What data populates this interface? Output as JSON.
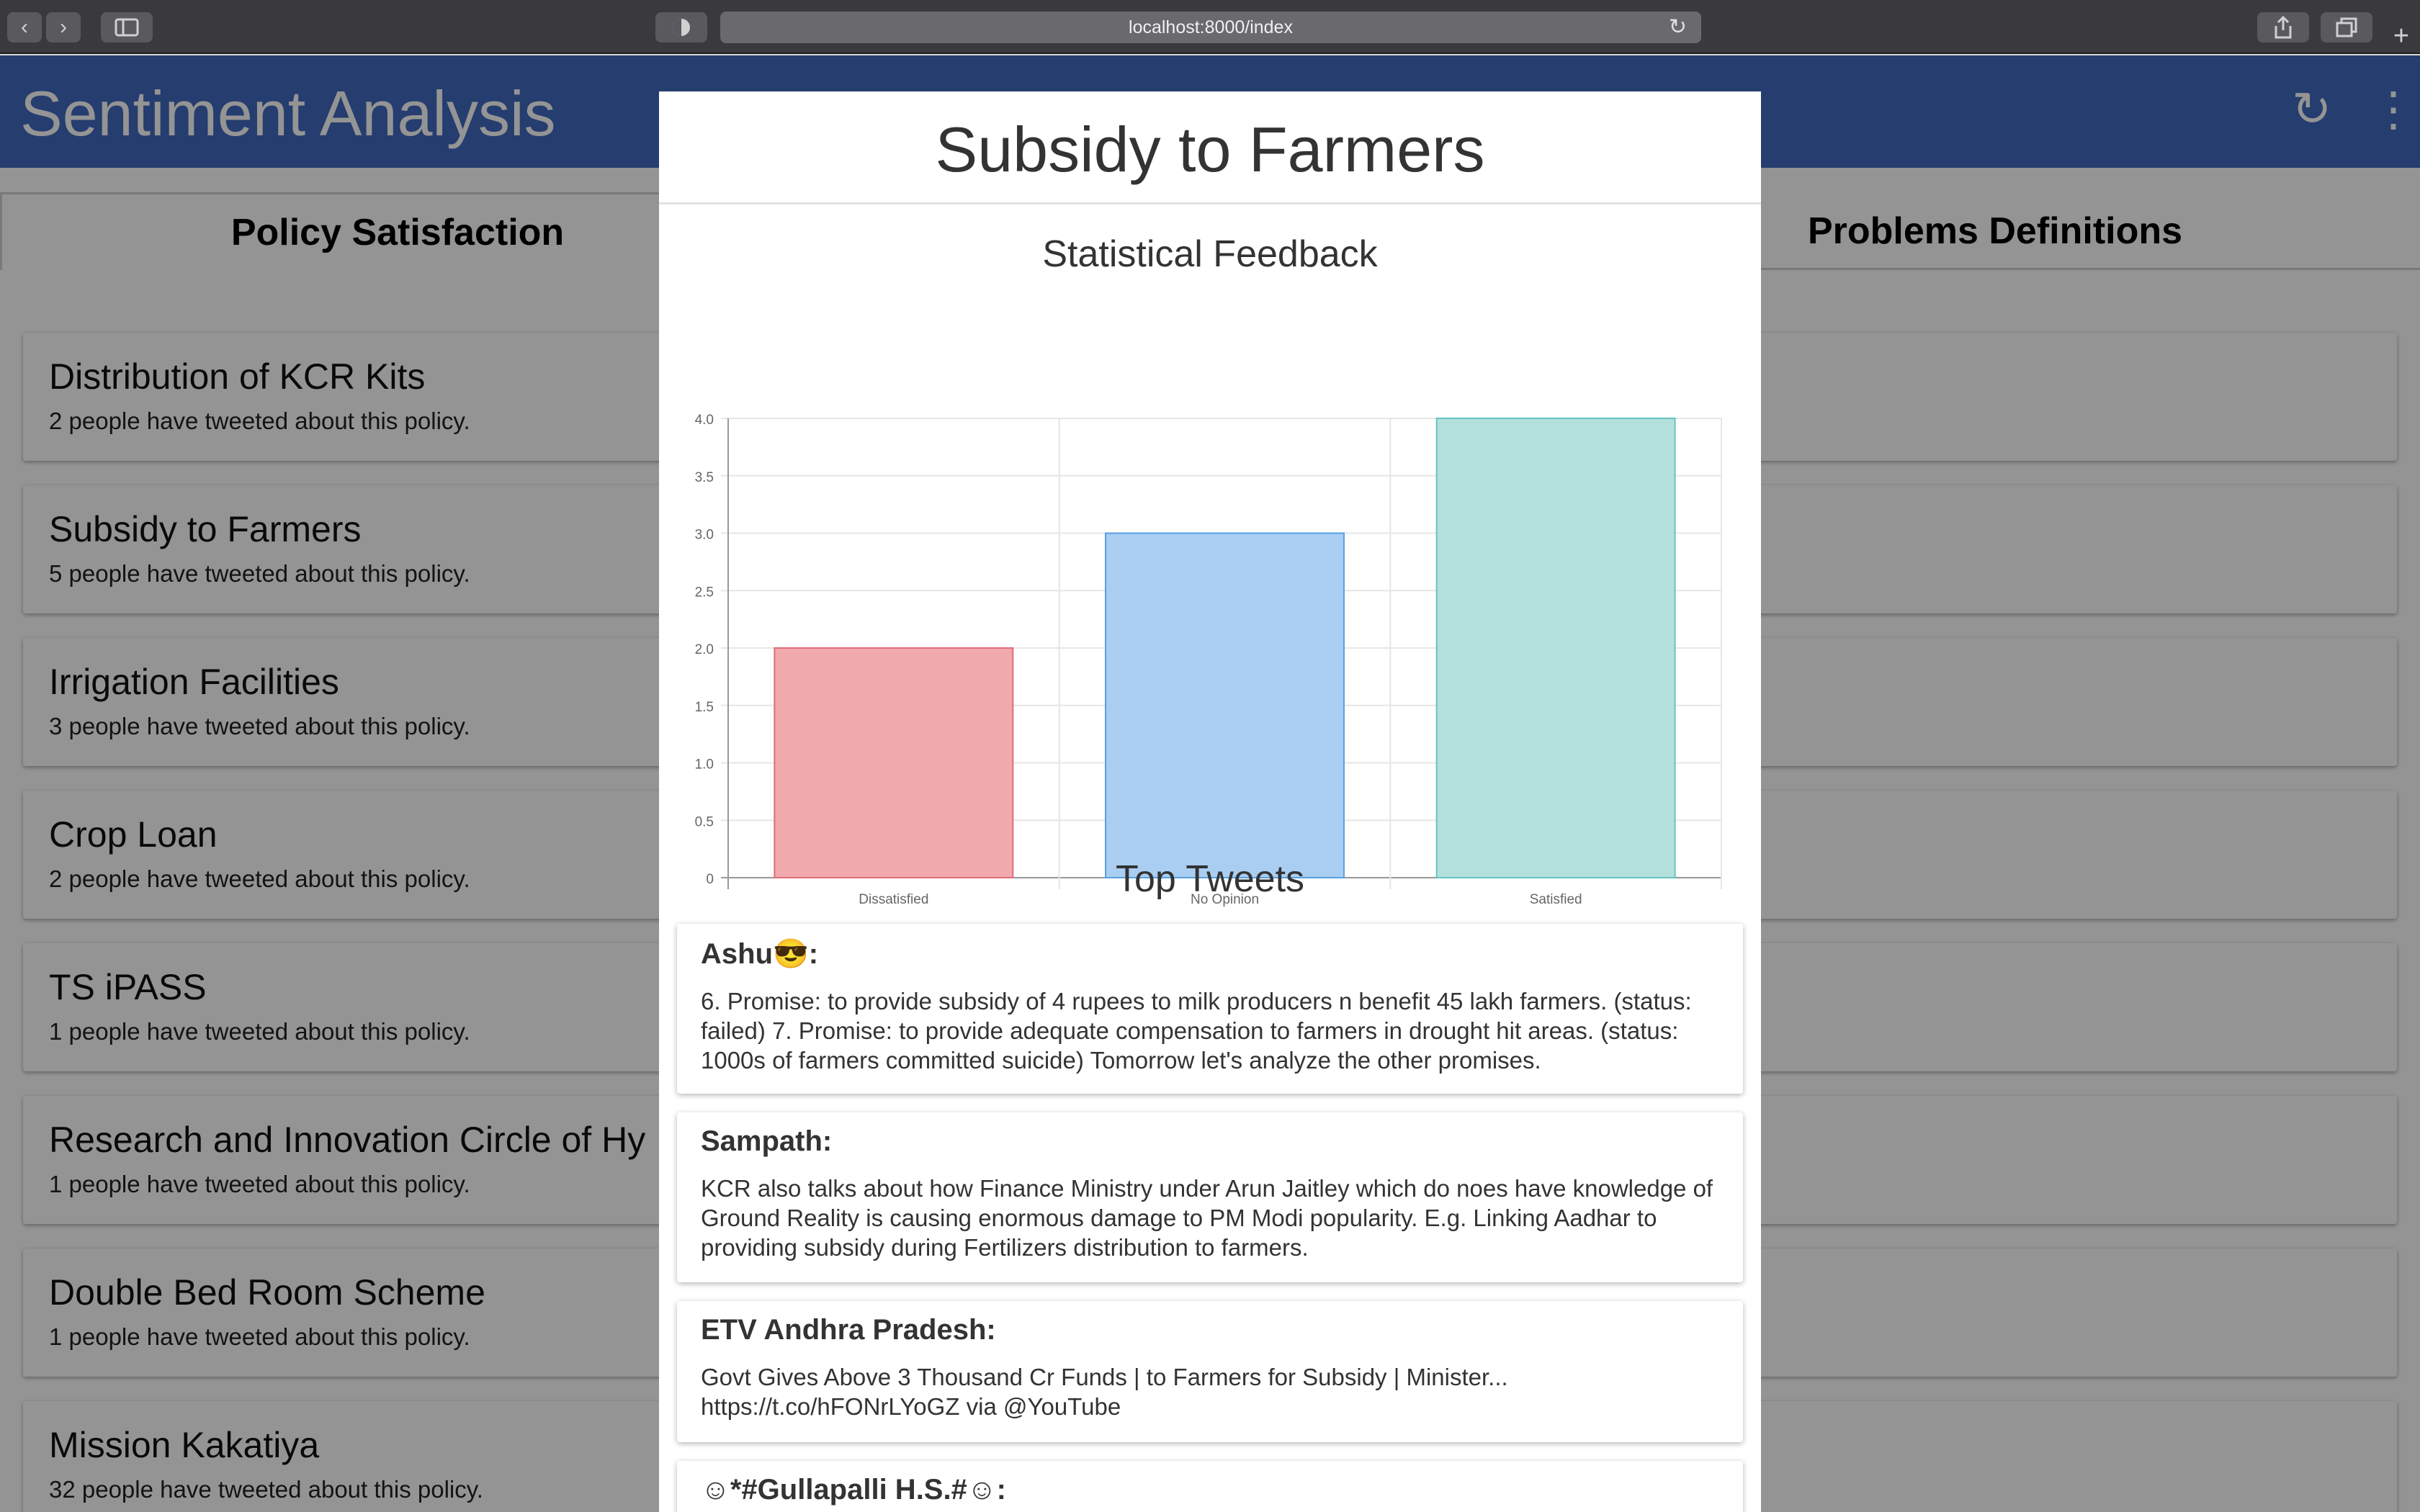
{
  "browser": {
    "url": "localhost:8000/index"
  },
  "app": {
    "title": "Sentiment Analysis"
  },
  "tabs": [
    {
      "label": "Policy Satisfaction"
    },
    {
      "label": "Problems Definitions"
    }
  ],
  "policies": [
    {
      "title": "Distribution of KCR Kits",
      "subtitle": "2 people have tweeted about this policy."
    },
    {
      "title": "Subsidy to Farmers",
      "subtitle": "5 people have tweeted about this policy."
    },
    {
      "title": "Irrigation Facilities",
      "subtitle": "3 people have tweeted about this policy."
    },
    {
      "title": "Crop Loan",
      "subtitle": "2 people have tweeted about this policy."
    },
    {
      "title": "TS iPASS",
      "subtitle": "1 people have tweeted about this policy."
    },
    {
      "title": "Research and Innovation Circle of Hy",
      "subtitle": "1 people have tweeted about this policy."
    },
    {
      "title": "Double Bed Room Scheme",
      "subtitle": "1 people have tweeted about this policy."
    },
    {
      "title": "Mission Kakatiya",
      "subtitle": "32 people have tweeted about this policy."
    }
  ],
  "modal": {
    "title": "Subsidy to Farmers",
    "chart_heading": "Statistical Feedback",
    "tweets_heading": "Top Tweets",
    "tweets": [
      {
        "user": "Ashu😎:",
        "text": "6. Promise: to provide subsidy of 4 rupees to milk producers n benefit 45 lakh farmers. (status: failed) 7. Promise: to provide adequate compensation to farmers in drought hit areas. (status: 1000s of farmers committed suicide) Tomorrow let's analyze the other promises."
      },
      {
        "user": "Sampath:",
        "text": "KCR also talks about how Finance Ministry under Arun Jaitley which do noes have knowledge of Ground Reality is causing enormous damage to PM Modi popularity. E.g. Linking Aadhar to providing subsidy during Fertilizers distribution to farmers."
      },
      {
        "user": "ETV Andhra Pradesh:",
        "text": "Govt Gives Above 3 Thousand Cr Funds | to Farmers for Subsidy | Minister... https://t.co/hFONrLYoGZ via @YouTube"
      },
      {
        "user": "☺*#Gullapalli H.S.#☺:",
        "text": ""
      }
    ]
  },
  "chart_data": {
    "type": "bar",
    "categories": [
      "Dissatisfied",
      "No Opinion",
      "Satisfied"
    ],
    "values": [
      2,
      3,
      4
    ],
    "colors": [
      "#f0a9ad",
      "#a9cef2",
      "#b3e0dd"
    ],
    "borders": [
      "#e06d78",
      "#5a9fe0",
      "#66c5bf"
    ],
    "ylim": [
      0,
      4
    ],
    "yticks": [
      "0",
      "0.5",
      "1.0",
      "1.5",
      "2.0",
      "2.5",
      "3.0",
      "3.5",
      "4.0"
    ],
    "grid": true,
    "legend": "none"
  },
  "icons": {
    "back": "chevron-left-icon",
    "forward": "chevron-right-icon",
    "sidebar": "sidebar-icon",
    "privacy": "shield-icon",
    "reload": "reload-icon",
    "share": "share-icon",
    "tabs": "tabs-icon",
    "new_tab": "plus-icon",
    "refresh": "refresh-icon",
    "more": "more-vertical-icon"
  }
}
